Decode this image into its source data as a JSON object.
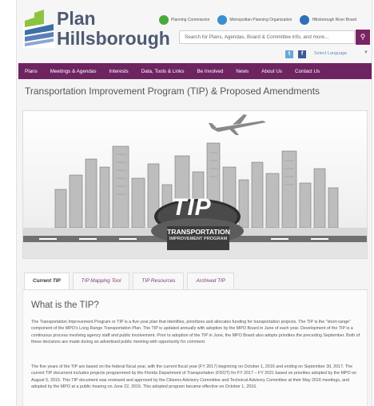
{
  "header": {
    "logo_line1": "Plan",
    "logo_line2": "Hillsborough",
    "partners": [
      {
        "label": "Planning Commission",
        "color": "#4aa83c"
      },
      {
        "label": "Metropolitan Planning Organization",
        "color": "#3a8fd0"
      },
      {
        "label": "Hillsborough River Board",
        "color": "#2f6fb8"
      }
    ],
    "search_placeholder": "Search for Plans, Agendas, Board & Committee info, and more...",
    "language_label": "Select Language",
    "social": [
      "twitter-icon",
      "facebook-icon"
    ]
  },
  "nav": [
    "Plans",
    "Meetings & Agendas",
    "Interests",
    "Data, Tools & Links",
    "Be Involved",
    "News",
    "About Us",
    "Contact Us"
  ],
  "page_title": "Transportation Improvement Program (TIP) & Proposed Amendments",
  "banner": {
    "tip_logo": "TIP",
    "line1": "TRANSPORTATION",
    "line2": "IMPROVEMENT PROGRAM"
  },
  "tabs": [
    "Current TIP",
    "TIP Mapping Tool",
    "TIP Resources",
    "Archived TIP"
  ],
  "section_title": "What is the TIP?",
  "paragraph1": "The Transportation Improvement Program or TIP is a five year plan that identifies, prioritizes and allocates funding for transportation projects. The TIP is the \"short-range\" component of the MPO's Long Range Transportation Plan. The TIP is updated annually with adoption by the MPO Board in June of each year.  Development of the TIP is a continuous process involving agency staff and public involvement.  Prior to adoption of the TIP in June, the MPO Board also adopts priorities the preceding September.  Both of these decisions are made during an advertised public meeting with opportunity for comment.",
  "paragraph2": "The five years of the TIP are based on the federal fiscal year, with the current fiscal year (FY 2017) beginning on October 1, 2016 and ending on September 30, 2017. The current TIP document includes projects programmed by the Florida Department of Transportation (FDOT) for FY 2017 – FY 2021 based on priorities adopted by the MPO on August 5, 2015. This TIP document was reviewed and approved by the Citizens Advisory Committee and Technical Advisory Committee at their May 2016 meetings, and adopted by the MPO at a public hearing on June 22, 2016.  This adopted program became effective on October 1, 2016."
}
